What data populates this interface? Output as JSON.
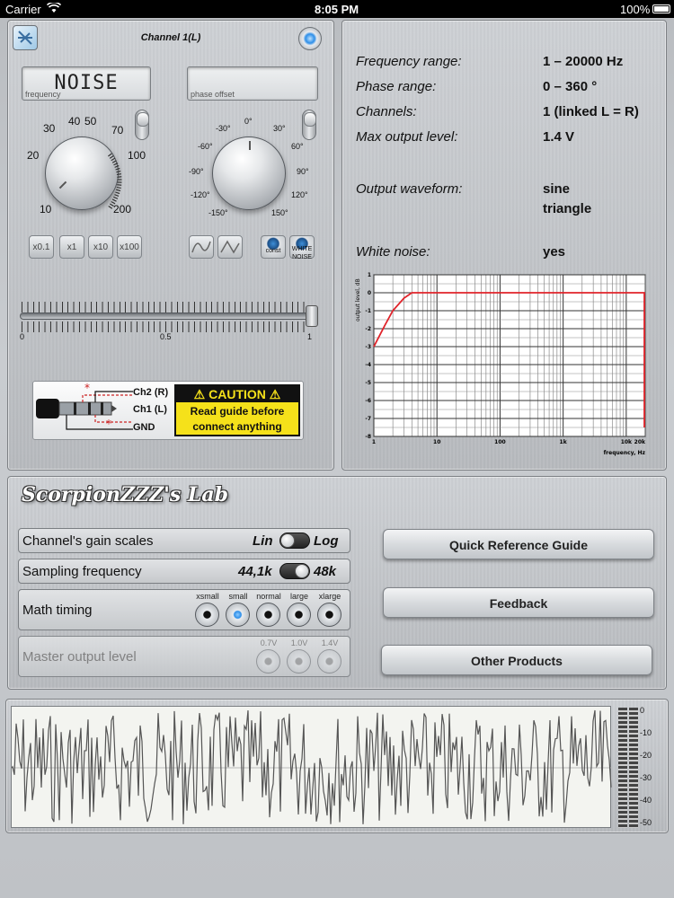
{
  "status_bar": {
    "carrier": "Carrier",
    "time": "8:05 PM",
    "battery": "100%"
  },
  "channel": {
    "title": "Channel 1(L)",
    "frequency_display": "NOISE",
    "frequency_label": "frequency",
    "phase_display": "",
    "phase_label": "phase offset",
    "freq_knob_labels": [
      "10",
      "20",
      "30",
      "40",
      "50",
      "70",
      "100",
      "200"
    ],
    "phase_knob_labels": [
      "0°",
      "30°",
      "60°",
      "90°",
      "120°",
      "150°",
      "-30°",
      "-60°",
      "-90°",
      "-120°",
      "-150°"
    ],
    "multiplier_buttons": [
      "x0.1",
      "x1",
      "x10",
      "x100"
    ],
    "const_label": "const",
    "white_noise_label": "WHITE NOISE",
    "slider_labels": [
      "0",
      "0.5",
      "1"
    ],
    "slider_value": 1.0,
    "plate": {
      "ch2": "Ch2 (R)",
      "ch1": "Ch1 (L)",
      "gnd": "GND",
      "caution_title": "CAUTION",
      "caution_line1": "Read guide before",
      "caution_line2": "connect anything"
    }
  },
  "specs": {
    "freq_range_k": "Frequency range:",
    "freq_range_v": "1 – 20000 Hz",
    "phase_range_k": "Phase range:",
    "phase_range_v": "0 – 360 °",
    "channels_k": "Channels:",
    "channels_v": "1 (linked L = R)",
    "max_out_k": "Max output level:",
    "max_out_v": "1.4 V",
    "waveform_k": "Output waveform:",
    "waveform_v1": "sine",
    "waveform_v2": "triangle",
    "noise_k": "White noise:",
    "noise_v": "yes"
  },
  "chart_data": {
    "type": "line",
    "title": "",
    "xlabel": "frequency, Hz",
    "ylabel": "output level, dB",
    "x_ticks": [
      "1",
      "10",
      "100",
      "1k",
      "10k",
      "20k"
    ],
    "y_ticks": [
      "1",
      "0",
      "-1",
      "-2",
      "-3",
      "-4",
      "-5",
      "-6",
      "-7",
      "-8"
    ],
    "xscale": "log",
    "xlim": [
      1,
      20000
    ],
    "ylim": [
      -8,
      1
    ],
    "grid": true,
    "series": [
      {
        "x": [
          1,
          1.5,
          2,
          3,
          4,
          5,
          20000,
          20000
        ],
        "y": [
          -3,
          -1.8,
          -1.0,
          -0.3,
          0,
          0,
          0,
          -7.5
        ]
      }
    ],
    "color": "#e0232a"
  },
  "settings": {
    "logo": "ScorpionZZZ's Lab",
    "gain_label": "Channel's gain scales",
    "gain_left": "Lin",
    "gain_right": "Log",
    "sampling_label": "Sampling frequency",
    "sampling_left": "44,1k",
    "sampling_right": "48k",
    "math_label": "Math timing",
    "math_options": [
      "xsmall",
      "small",
      "normal",
      "large",
      "xlarge"
    ],
    "math_selected": "small",
    "master_label": "Master output level",
    "master_options": [
      "0.7V",
      "1.0V",
      "1.4V"
    ],
    "btn_guide": "Quick Reference Guide",
    "btn_feedback": "Feedback",
    "btn_products": "Other Products"
  },
  "scope": {
    "meter_ticks": [
      "0",
      "-10",
      "-20",
      "-30",
      "-40",
      "-50"
    ]
  },
  "colors": {
    "accent_blue": "#2d8ee8",
    "caution_yellow": "#f5e11a",
    "response_red": "#e0232a"
  }
}
